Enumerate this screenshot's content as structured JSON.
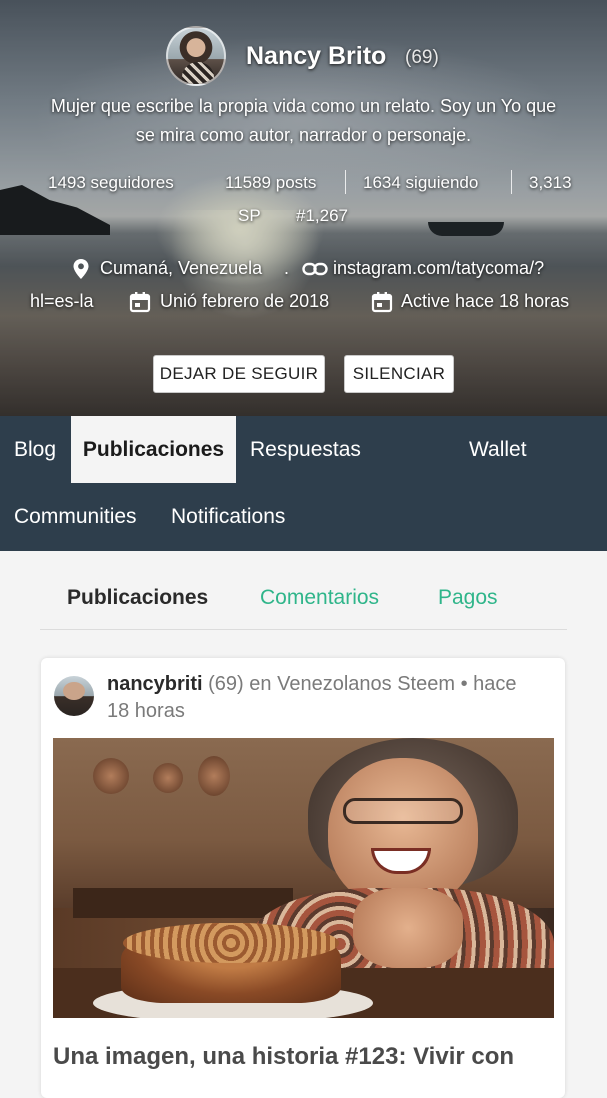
{
  "profile": {
    "name": "Nancy Brito",
    "reputation": "(69)",
    "bio_line1": "Mujer que escribe la propia vida como un relato. Soy un Yo que",
    "bio_line2": "se mira como autor, narrador o personaje.",
    "followers": "1493 seguidores",
    "posts": "11589 posts",
    "following": "1634 siguiendo",
    "sp_value": "3,313",
    "sp_label": "SP",
    "rank": "#1,267",
    "location": "Cumaná, Venezuela",
    "separator": ".",
    "website_line1": "instagram.com/tatycoma/?",
    "website_line2": "hl=es-la",
    "joined": "Unió febrero de 2018",
    "active": "Active hace 18 horas",
    "unfollow_button": "DEJAR DE SEGUIR",
    "mute_button": "SILENCIAR"
  },
  "tabs": {
    "blog": "Blog",
    "publicaciones": "Publicaciones",
    "respuestas": "Respuestas",
    "wallet": "Wallet",
    "communities": "Communities",
    "notifications": "Notifications",
    "active": "publicaciones"
  },
  "subtabs": {
    "publicaciones": "Publicaciones",
    "comentarios": "Comentarios",
    "pagos": "Pagos",
    "link_color": "#2fb58a"
  },
  "post": {
    "author": "nancybriti",
    "author_rep": "(69)",
    "in_label": "en",
    "community": "Venezolanos Steem",
    "bullet": "•",
    "time_line1": "hace",
    "time_line2": "18 horas",
    "title": "Una imagen, una historia #123: Vivir con"
  },
  "icons": {
    "location": "location-pin-icon",
    "link": "link-icon",
    "calendar": "calendar-icon"
  },
  "colors": {
    "tabbar_bg": "#2e3e4c",
    "active_tab_bg": "#f4f4f4"
  }
}
